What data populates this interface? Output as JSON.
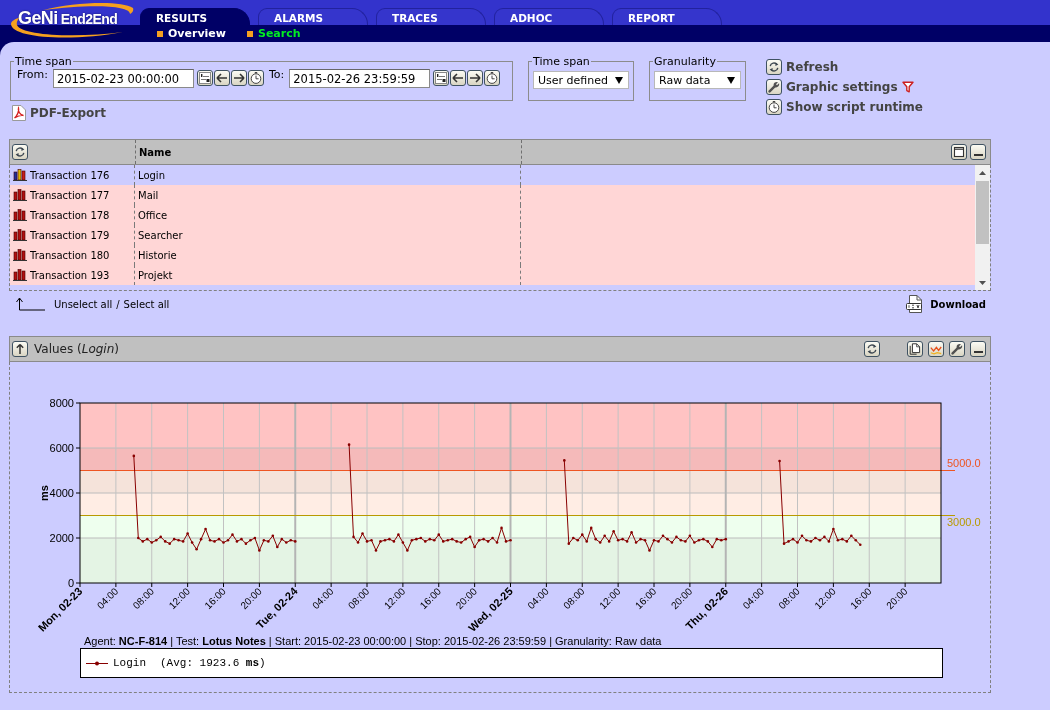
{
  "header": {
    "logo": {
      "primary": "GeNi",
      "secondary": "End2End"
    },
    "tabs": [
      {
        "label": "RESULTS",
        "selected": true
      },
      {
        "label": "ALARMS",
        "selected": false
      },
      {
        "label": "TRACES",
        "selected": false
      },
      {
        "label": "ADHOC",
        "selected": false
      },
      {
        "label": "REPORT",
        "selected": false
      }
    ],
    "subtabs": [
      {
        "label": "Overview",
        "selected": false
      },
      {
        "label": "Search",
        "selected": true
      }
    ]
  },
  "filters": {
    "range": {
      "legend": "Time span",
      "from_label": "From:",
      "from_value": "2015-02-23 00:00:00",
      "to_label": "To:",
      "to_value": "2015-02-26 23:59:59"
    },
    "selects": [
      {
        "legend": "Time span",
        "value": "User defined"
      },
      {
        "legend": "Granularity",
        "value": "Raw data"
      }
    ],
    "actions": [
      {
        "kind": "refresh",
        "label": "Refresh",
        "filtered": false
      },
      {
        "kind": "settings",
        "label": "Graphic settings",
        "filtered": true
      },
      {
        "kind": "runtime",
        "label": "Show script runtime",
        "filtered": false
      }
    ],
    "pdf_export": "PDF-Export"
  },
  "transactions": {
    "name_header": "Name",
    "rows": [
      {
        "transaction": "Transaction 176",
        "name": "Login",
        "selected": true
      },
      {
        "transaction": "Transaction 177",
        "name": "Mail",
        "selected": false
      },
      {
        "transaction": "Transaction 178",
        "name": "Office",
        "selected": false
      },
      {
        "transaction": "Transaction 179",
        "name": "Searcher",
        "selected": false
      },
      {
        "transaction": "Transaction 180",
        "name": "Historie",
        "selected": false
      },
      {
        "transaction": "Transaction 193",
        "name": "Projekt",
        "selected": false
      }
    ],
    "select_links": [
      "Unselect all",
      "Select all"
    ],
    "link_separator": "/",
    "download": "Download"
  },
  "values_panel": {
    "title": "Values (*Login*)",
    "chart_data": {
      "type": "line",
      "ylabel": "ms",
      "x": [
        "2015-02-23T06:00",
        "2015-02-23T06:30",
        "2015-02-23T07:00",
        "2015-02-23T07:30",
        "2015-02-23T08:00",
        "2015-02-23T08:30",
        "2015-02-23T09:00",
        "2015-02-23T09:30",
        "2015-02-23T10:00",
        "2015-02-23T10:30",
        "2015-02-23T11:00",
        "2015-02-23T11:30",
        "2015-02-23T12:00",
        "2015-02-23T12:30",
        "2015-02-23T13:00",
        "2015-02-23T13:30",
        "2015-02-23T14:00",
        "2015-02-23T14:30",
        "2015-02-23T15:00",
        "2015-02-23T15:30",
        "2015-02-23T16:00",
        "2015-02-23T16:30",
        "2015-02-23T17:00",
        "2015-02-23T17:30",
        "2015-02-23T18:00",
        "2015-02-23T18:30",
        "2015-02-23T19:00",
        "2015-02-23T19:30",
        "2015-02-23T20:00",
        "2015-02-23T20:30",
        "2015-02-23T21:00",
        "2015-02-23T21:30",
        "2015-02-23T22:00",
        "2015-02-23T22:30",
        "2015-02-23T23:00",
        "2015-02-23T23:30",
        "2015-02-24T00:00",
        "2015-02-24T06:00",
        "2015-02-24T06:30",
        "2015-02-24T07:00",
        "2015-02-24T07:30",
        "2015-02-24T08:00",
        "2015-02-24T08:30",
        "2015-02-24T09:00",
        "2015-02-24T09:30",
        "2015-02-24T10:00",
        "2015-02-24T10:30",
        "2015-02-24T11:00",
        "2015-02-24T11:30",
        "2015-02-24T12:00",
        "2015-02-24T12:30",
        "2015-02-24T13:00",
        "2015-02-24T13:30",
        "2015-02-24T14:00",
        "2015-02-24T14:30",
        "2015-02-24T15:00",
        "2015-02-24T15:30",
        "2015-02-24T16:00",
        "2015-02-24T16:30",
        "2015-02-24T17:00",
        "2015-02-24T17:30",
        "2015-02-24T18:00",
        "2015-02-24T18:30",
        "2015-02-24T19:00",
        "2015-02-24T19:30",
        "2015-02-24T20:00",
        "2015-02-24T20:30",
        "2015-02-24T21:00",
        "2015-02-24T21:30",
        "2015-02-24T22:00",
        "2015-02-24T22:30",
        "2015-02-24T23:00",
        "2015-02-24T23:30",
        "2015-02-25T00:00",
        "2015-02-25T06:00",
        "2015-02-25T06:30",
        "2015-02-25T07:00",
        "2015-02-25T07:30",
        "2015-02-25T08:00",
        "2015-02-25T08:30",
        "2015-02-25T09:00",
        "2015-02-25T09:30",
        "2015-02-25T10:00",
        "2015-02-25T10:30",
        "2015-02-25T11:00",
        "2015-02-25T11:30",
        "2015-02-25T12:00",
        "2015-02-25T12:30",
        "2015-02-25T13:00",
        "2015-02-25T13:30",
        "2015-02-25T14:00",
        "2015-02-25T14:30",
        "2015-02-25T15:00",
        "2015-02-25T15:30",
        "2015-02-25T16:00",
        "2015-02-25T16:30",
        "2015-02-25T17:00",
        "2015-02-25T17:30",
        "2015-02-25T18:00",
        "2015-02-25T18:30",
        "2015-02-25T19:00",
        "2015-02-25T19:30",
        "2015-02-25T20:00",
        "2015-02-25T20:30",
        "2015-02-25T21:00",
        "2015-02-25T21:30",
        "2015-02-25T22:00",
        "2015-02-25T22:30",
        "2015-02-25T23:00",
        "2015-02-25T23:30",
        "2015-02-26T00:00",
        "2015-02-26T06:00",
        "2015-02-26T06:30",
        "2015-02-26T07:00",
        "2015-02-26T07:30",
        "2015-02-26T08:00",
        "2015-02-26T08:30",
        "2015-02-26T09:00",
        "2015-02-26T09:30",
        "2015-02-26T10:00",
        "2015-02-26T10:30",
        "2015-02-26T11:00",
        "2015-02-26T11:30",
        "2015-02-26T12:00",
        "2015-02-26T12:30",
        "2015-02-26T13:00",
        "2015-02-26T13:30",
        "2015-02-26T14:00",
        "2015-02-26T14:30",
        "2015-02-26T15:00"
      ],
      "series": [
        {
          "name": "Login",
          "color": "#880000",
          "values": [
            5650,
            2000,
            1850,
            1950,
            1800,
            1900,
            2050,
            1850,
            1750,
            1950,
            1900,
            1850,
            2200,
            1800,
            1500,
            1950,
            2400,
            1900,
            1850,
            1950,
            1800,
            1900,
            2150,
            1850,
            1950,
            1750,
            1900,
            2000,
            1450,
            1900,
            1850,
            2100,
            1600,
            1950,
            1800,
            1900,
            1850,
            6150,
            2050,
            1800,
            2200,
            1850,
            1900,
            1450,
            1850,
            1900,
            1950,
            1850,
            2150,
            1800,
            1450,
            1900,
            1950,
            2000,
            1850,
            1950,
            1900,
            2150,
            1850,
            1900,
            1950,
            1850,
            1800,
            1950,
            2050,
            1600,
            1900,
            1950,
            1850,
            2000,
            1800,
            2450,
            1850,
            1900,
            5450,
            1750,
            2000,
            1900,
            2150,
            1850,
            2450,
            1950,
            1800,
            2100,
            1850,
            2300,
            1900,
            1950,
            1850,
            2250,
            1800,
            1950,
            1900,
            1450,
            1900,
            1850,
            2100,
            1950,
            1800,
            2050,
            1900,
            1850,
            2100,
            1800,
            1900,
            1950,
            1850,
            1600,
            1950,
            1900,
            1950,
            5420,
            1750,
            1850,
            1950,
            1800,
            2100,
            1900,
            1850,
            2000,
            1900,
            2050,
            1850,
            2400,
            1900,
            1950,
            1850,
            2100,
            1900,
            1700
          ]
        }
      ],
      "xlim": [
        "2015-02-23T00:00",
        "2015-02-27T00:00"
      ],
      "ylim": [
        0,
        8000
      ],
      "xticks": [
        {
          "value": "2015-02-23T00:00",
          "label": "Mon, 02-23"
        },
        {
          "value": "2015-02-23T04:00",
          "label": "04:00"
        },
        {
          "value": "2015-02-23T08:00",
          "label": "08:00"
        },
        {
          "value": "2015-02-23T12:00",
          "label": "12:00"
        },
        {
          "value": "2015-02-23T16:00",
          "label": "16:00"
        },
        {
          "value": "2015-02-23T20:00",
          "label": "20:00"
        },
        {
          "value": "2015-02-24T00:00",
          "label": "Tue, 02-24"
        },
        {
          "value": "2015-02-24T04:00",
          "label": "04:00"
        },
        {
          "value": "2015-02-24T08:00",
          "label": "08:00"
        },
        {
          "value": "2015-02-24T12:00",
          "label": "12:00"
        },
        {
          "value": "2015-02-24T16:00",
          "label": "16:00"
        },
        {
          "value": "2015-02-24T20:00",
          "label": "20:00"
        },
        {
          "value": "2015-02-25T00:00",
          "label": "Wed, 02-25"
        },
        {
          "value": "2015-02-25T04:00",
          "label": "04:00"
        },
        {
          "value": "2015-02-25T08:00",
          "label": "08:00"
        },
        {
          "value": "2015-02-25T12:00",
          "label": "12:00"
        },
        {
          "value": "2015-02-25T16:00",
          "label": "16:00"
        },
        {
          "value": "2015-02-25T20:00",
          "label": "20:00"
        },
        {
          "value": "2015-02-26T00:00",
          "label": "Thu, 02-26"
        },
        {
          "value": "2015-02-26T04:00",
          "label": "04:00"
        },
        {
          "value": "2015-02-26T08:00",
          "label": "08:00"
        },
        {
          "value": "2015-02-26T12:00",
          "label": "12:00"
        },
        {
          "value": "2015-02-26T16:00",
          "label": "16:00"
        },
        {
          "value": "2015-02-26T20:00",
          "label": "20:00"
        }
      ],
      "yticks": [
        0,
        2000,
        4000,
        6000,
        8000
      ],
      "grid": true,
      "ref_lines": [
        {
          "axis": "y",
          "value": 5000,
          "label": "5000.0",
          "color": "#ee5522"
        },
        {
          "axis": "y",
          "value": 3000,
          "label": "3000.0",
          "color": "#b89a00"
        }
      ],
      "bands": [
        {
          "axis": "y",
          "from": 0,
          "to": 2000,
          "color": "#e4f4e4"
        },
        {
          "axis": "y",
          "from": 2000,
          "to": 3000,
          "color": "#eeffee"
        },
        {
          "axis": "y",
          "from": 3000,
          "to": 4000,
          "color": "#ffede4"
        },
        {
          "axis": "y",
          "from": 4000,
          "to": 5000,
          "color": "#f5e3da"
        },
        {
          "axis": "y",
          "from": 5000,
          "to": 6000,
          "color": "#f5baba"
        },
        {
          "axis": "y",
          "from": 6000,
          "to": 8000,
          "color": "#ffc3c3"
        }
      ]
    },
    "caption": "Agent: **NC-F-814** | Test: **Lotus Notes** | Start: 2015-02-23 00:00:00 | Stop: 2015-02-26 23:59:59 | Granularity: Raw data",
    "legend_summary": "(Avg: 1923.6 **ms**)"
  }
}
